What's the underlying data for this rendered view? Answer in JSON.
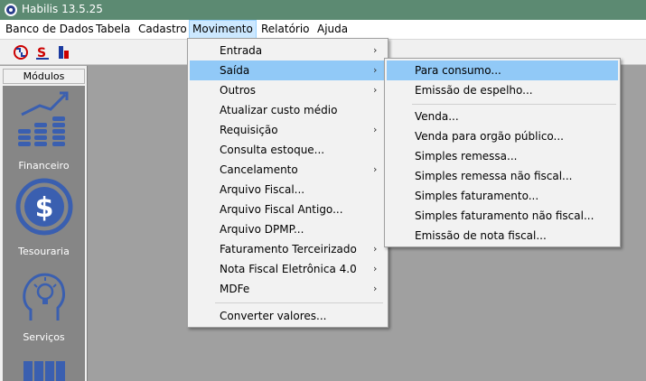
{
  "window": {
    "title": "Habilis 13.5.25"
  },
  "menubar": {
    "items": [
      {
        "label": "Banco de Dados"
      },
      {
        "label": "Tabela"
      },
      {
        "label": "Cadastro"
      },
      {
        "label": "Movimento"
      },
      {
        "label": "Relatório"
      },
      {
        "label": "Ajuda"
      }
    ]
  },
  "sidebar": {
    "header": "Módulos",
    "modules": [
      {
        "label": "Financeiro",
        "icon": "financial-chart-icon"
      },
      {
        "label": "Tesouraria",
        "icon": "dollar-coin-icon"
      },
      {
        "label": "Serviços",
        "icon": "idea-head-icon"
      }
    ]
  },
  "movimento_menu": {
    "items": [
      {
        "label": "Entrada",
        "submenu": true
      },
      {
        "label": "Saída",
        "submenu": true,
        "highlighted": true
      },
      {
        "label": "Outros",
        "submenu": true
      },
      {
        "label": "Atualizar custo médio"
      },
      {
        "label": "Requisição",
        "submenu": true
      },
      {
        "label": "Consulta estoque..."
      },
      {
        "label": "Cancelamento",
        "submenu": true
      },
      {
        "label": "Arquivo Fiscal..."
      },
      {
        "label": "Arquivo Fiscal Antigo..."
      },
      {
        "label": "Arquivo DPMP..."
      },
      {
        "label": "Faturamento Terceirizado",
        "submenu": true
      },
      {
        "label": "Nota Fiscal Eletrônica 4.0",
        "submenu": true
      },
      {
        "label": "MDFe",
        "submenu": true
      },
      {
        "label": "Converter valores..."
      }
    ]
  },
  "saida_submenu": {
    "items": [
      {
        "label": "Para consumo...",
        "highlighted": true
      },
      {
        "label": "Emissão de espelho..."
      },
      {
        "label": "Venda..."
      },
      {
        "label": "Venda para orgão público..."
      },
      {
        "label": "Simples remessa..."
      },
      {
        "label": "Simples remessa não fiscal..."
      },
      {
        "label": "Simples faturamento..."
      },
      {
        "label": "Simples faturamento não fiscal..."
      },
      {
        "label": "Emissão de nota fiscal..."
      }
    ]
  },
  "colors": {
    "titlebar": "#5c8a72",
    "highlight": "#91c9f7",
    "workspace": "#a0a0a0",
    "module_icon": "#3a5fb0"
  }
}
